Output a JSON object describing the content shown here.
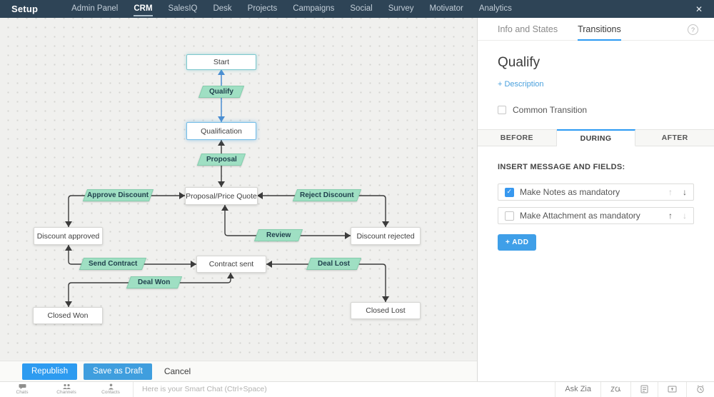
{
  "navbar": {
    "brand": "Setup",
    "items": [
      "Admin Panel",
      "CRM",
      "SalesIQ",
      "Desk",
      "Projects",
      "Campaigns",
      "Social",
      "Survey",
      "Motivator",
      "Analytics"
    ],
    "active_item": "CRM",
    "close_label": "✕"
  },
  "canvas": {
    "states": {
      "start": "Start",
      "qualification": "Qualification",
      "proposal_price_quote": "Proposal/Price Quote",
      "discount_approved": "Discount approved",
      "discount_rejected": "Discount rejected",
      "contract_sent": "Contract sent",
      "closed_won": "Closed Won",
      "closed_lost": "Closed Lost"
    },
    "transitions": {
      "qualify": "Qualify",
      "proposal": "Proposal",
      "approve_discount": "Approve Discount",
      "reject_discount": "Reject Discount",
      "review": "Review",
      "send_contract": "Send Contract",
      "deal_lost": "Deal Lost",
      "deal_won": "Deal Won"
    }
  },
  "panel": {
    "tabs": {
      "info_states": "Info and States",
      "transitions": "Transitions"
    },
    "help_icon": "?",
    "title": "Qualify",
    "description_link": "+ Description",
    "common_transition_label": "Common Transition",
    "stage_tabs": {
      "before": "BEFORE",
      "during": "DURING",
      "after": "AFTER"
    },
    "section_label": "INSERT MESSAGE AND FIELDS:",
    "rows": [
      {
        "label": "Make Notes as mandatory",
        "checked": true
      },
      {
        "label": "Make Attachment as mandatory",
        "checked": false
      }
    ],
    "up_arrow": "↑",
    "down_arrow": "↓",
    "add_button": "+ ADD"
  },
  "action_bar": {
    "republish": "Republish",
    "save_draft": "Save as Draft",
    "cancel": "Cancel"
  },
  "taskbar": {
    "items": [
      {
        "label": "Chats"
      },
      {
        "label": "Channels"
      },
      {
        "label": "Contacts"
      }
    ],
    "smart_chat_hint": "Here is your Smart Chat (Ctrl+Space)",
    "ask_zia": "Ask Zia"
  },
  "colors": {
    "accent_blue": "#2b9af3",
    "transition_green": "#9fdfc3",
    "navbar_bg": "#2e4456",
    "selected_line": "#4a8ed2"
  }
}
